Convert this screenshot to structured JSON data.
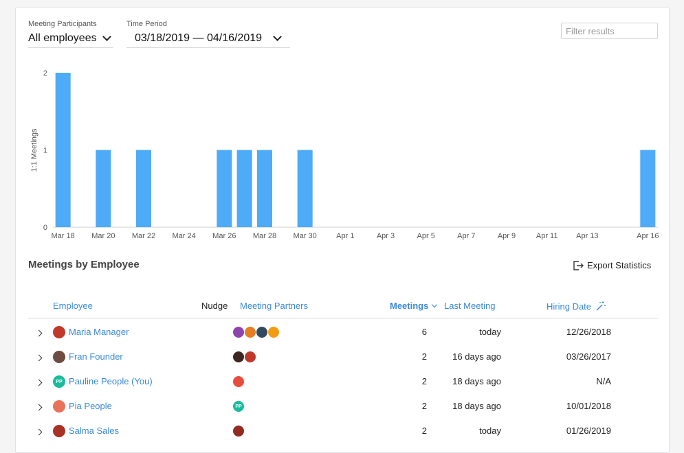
{
  "filters": {
    "participants_label": "Meeting Participants",
    "participants_value": "All employees",
    "period_label": "Time Period",
    "period_value": "03/18/2019 — 04/16/2019",
    "search_placeholder": "Filter results"
  },
  "chart_data": {
    "type": "bar",
    "ylabel": "1:1 Meetings",
    "ylim": [
      0,
      2
    ],
    "yticks": [
      0,
      1,
      2
    ],
    "categories": [
      "Mar 18",
      "Mar 19",
      "Mar 20",
      "Mar 21",
      "Mar 22",
      "Mar 23",
      "Mar 24",
      "Mar 25",
      "Mar 26",
      "Mar 27",
      "Mar 28",
      "Mar 29",
      "Mar 30",
      "Mar 31",
      "Apr 1",
      "Apr 2",
      "Apr 3",
      "Apr 4",
      "Apr 5",
      "Apr 6",
      "Apr 7",
      "Apr 8",
      "Apr 9",
      "Apr 10",
      "Apr 11",
      "Apr 12",
      "Apr 13",
      "Apr 14",
      "Apr 15",
      "Apr 16"
    ],
    "xtick_labels": [
      "Mar 18",
      "Mar 20",
      "Mar 22",
      "Mar 24",
      "Mar 26",
      "Mar 28",
      "Mar 30",
      "Apr 1",
      "Apr 3",
      "Apr 5",
      "Apr 7",
      "Apr 9",
      "Apr 11",
      "Apr 13",
      "Apr 16"
    ],
    "values": [
      2,
      0,
      1,
      0,
      1,
      0,
      0,
      0,
      1,
      1,
      1,
      0,
      1,
      0,
      0,
      0,
      0,
      0,
      0,
      0,
      0,
      0,
      0,
      0,
      0,
      0,
      0,
      0,
      0,
      1
    ],
    "color": "#4dabf7",
    "grid": false
  },
  "section": {
    "title": "Meetings by Employee",
    "export_label": "Export Statistics"
  },
  "table": {
    "headers": {
      "employee": "Employee",
      "nudge": "Nudge",
      "partners": "Meeting Partners",
      "meetings": "Meetings",
      "last_meeting": "Last Meeting",
      "hiring_date": "Hiring Date"
    },
    "rows": [
      {
        "name": "Maria Manager",
        "avatar_color": "#c0392b",
        "partners": [
          "#8e44ad",
          "#e67e22",
          "#34495e",
          "#f39c12"
        ],
        "meetings": "6",
        "last_meeting": "today",
        "hiring_date": "12/26/2018"
      },
      {
        "name": "Fran Founder",
        "avatar_color": "#6d4c41",
        "partners": [
          "#3e2723",
          "#c0392b"
        ],
        "meetings": "2",
        "last_meeting": "16 days ago",
        "hiring_date": "03/26/2017"
      },
      {
        "name": "Pauline People (You)",
        "avatar_initials": "PP",
        "avatar_color": "#1abc9c",
        "partners": [
          "#e74c3c"
        ],
        "meetings": "2",
        "last_meeting": "18 days ago",
        "hiring_date": "N/A"
      },
      {
        "name": "Pia People",
        "avatar_color": "#e8735a",
        "partners_initials": "PP",
        "partners": [
          "#1abc9c"
        ],
        "meetings": "2",
        "last_meeting": "18 days ago",
        "hiring_date": "10/01/2018"
      },
      {
        "name": "Salma Sales",
        "avatar_color": "#a93226",
        "partners": [
          "#922b21"
        ],
        "meetings": "2",
        "last_meeting": "today",
        "hiring_date": "01/26/2019"
      }
    ]
  }
}
